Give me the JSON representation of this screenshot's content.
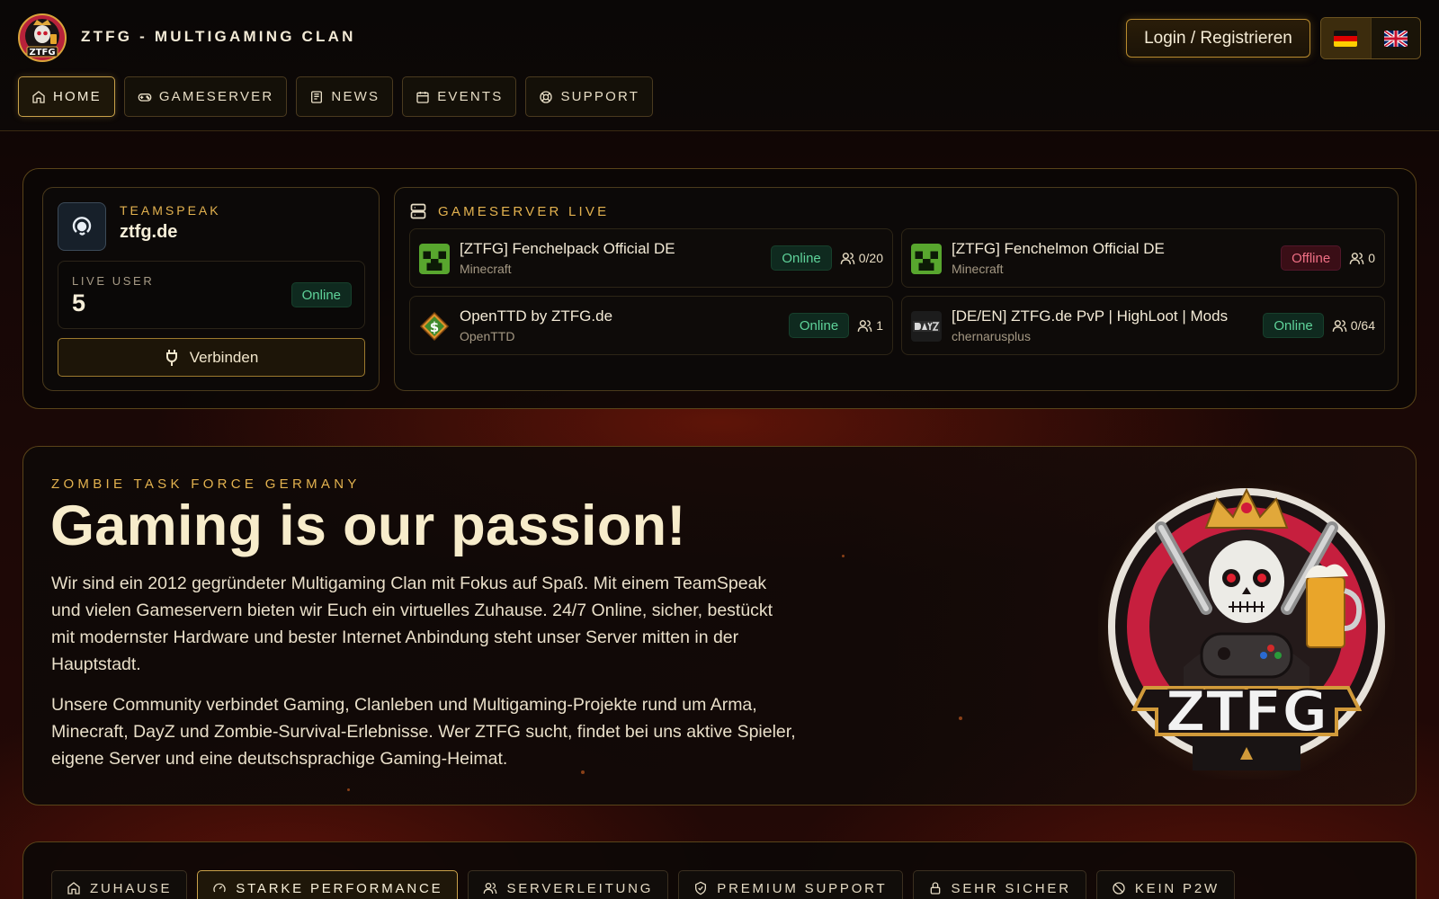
{
  "header": {
    "brand": "ZTFG - MULTIGAMING CLAN",
    "login_label": "Login / Registrieren",
    "languages": [
      {
        "code": "de",
        "active": true
      },
      {
        "code": "en",
        "active": false
      }
    ],
    "logo_text": "ZTFG"
  },
  "nav": {
    "items": [
      {
        "label": "HOME",
        "icon": "home-icon",
        "active": true
      },
      {
        "label": "GAMESERVER",
        "icon": "gamepad-icon",
        "active": false
      },
      {
        "label": "NEWS",
        "icon": "newspaper-icon",
        "active": false
      },
      {
        "label": "EVENTS",
        "icon": "calendar-icon",
        "active": false
      },
      {
        "label": "SUPPORT",
        "icon": "lifebuoy-icon",
        "active": false
      }
    ]
  },
  "teamspeak": {
    "label": "TEAMSPEAK",
    "host": "ztfg.de",
    "live_label": "LIVE USER",
    "live_count": "5",
    "status": "Online",
    "connect_label": "Verbinden"
  },
  "gameservers": {
    "title": "GAMESERVER LIVE",
    "servers": [
      {
        "name": "[ZTFG] Fenchelpack Official DE",
        "game": "Minecraft",
        "status": "Online",
        "players": "0/20",
        "icon": "minecraft-icon"
      },
      {
        "name": "[ZTFG] Fenchelmon Official DE",
        "game": "Minecraft",
        "status": "Offline",
        "players": "0",
        "icon": "minecraft-icon"
      },
      {
        "name": "OpenTTD by ZTFG.de",
        "game": "OpenTTD",
        "status": "Online",
        "players": "1",
        "icon": "openttd-icon"
      },
      {
        "name": "[DE/EN] ZTFG.de PvP | HighLoot | Mods",
        "game": "chernarusplus",
        "status": "Online",
        "players": "0/64",
        "icon": "dayz-icon"
      }
    ]
  },
  "hero": {
    "kicker": "ZOMBIE TASK FORCE GERMANY",
    "title": "Gaming is our passion!",
    "paragraph1": "Wir sind ein 2012 gegründeter Multigaming Clan mit Fokus auf Spaß. Mit einem TeamSpeak und vielen Gameservern bieten wir Euch ein virtuelles Zuhause. 24/7 Online, sicher, bestückt mit modernster Hardware und bester Internet Anbindung steht unser Server mitten in der Hauptstadt.",
    "paragraph2": "Unsere Community verbindet Gaming, Clanleben und Multigaming-Projekte rund um Arma, Minecraft, DayZ und Zombie-Survival-Erlebnisse. Wer ZTFG sucht, findet bei uns aktive Spieler, eigene Server und eine deutschsprachige Gaming-Heimat.",
    "emblem_text": "ZTFG"
  },
  "features": {
    "tabs": [
      {
        "label": "ZUHAUSE",
        "icon": "home-icon",
        "active": false
      },
      {
        "label": "STARKE PERFORMANCE",
        "icon": "gauge-icon",
        "active": true
      },
      {
        "label": "SERVERLEITUNG",
        "icon": "users-icon",
        "active": false
      },
      {
        "label": "PREMIUM SUPPORT",
        "icon": "shield-check-icon",
        "active": false
      },
      {
        "label": "SEHR SICHER",
        "icon": "lock-icon",
        "active": false
      },
      {
        "label": "KEIN P2W",
        "icon": "no-coin-icon",
        "active": false
      }
    ]
  },
  "colors": {
    "accent_gold": "#e3b24f",
    "online": "#5fd39a",
    "offline": "#ef6f84",
    "background": "#120605"
  }
}
